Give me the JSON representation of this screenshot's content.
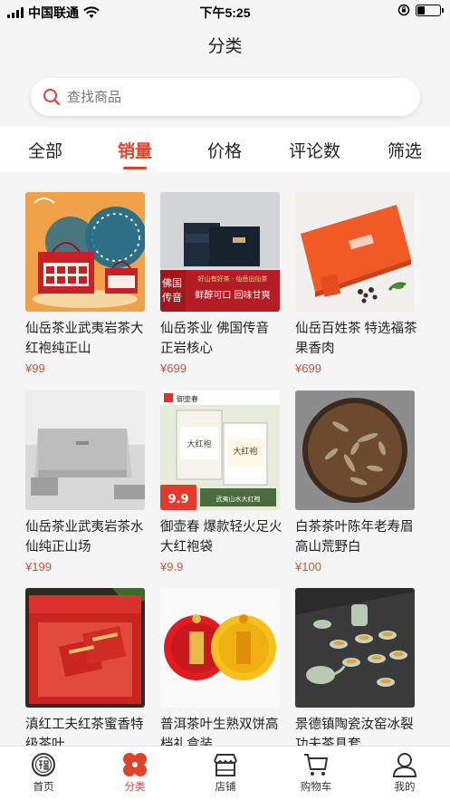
{
  "status_bar": {
    "carrier": "中国联通",
    "time": "下午5:25"
  },
  "nav": {
    "title": "分类"
  },
  "search": {
    "placeholder": "查找商品"
  },
  "tabs": [
    {
      "label": "全部",
      "active": false
    },
    {
      "label": "销量",
      "active": true
    },
    {
      "label": "价格",
      "active": false
    },
    {
      "label": "评论数",
      "active": false
    },
    {
      "label": "筛选",
      "active": false
    }
  ],
  "products": [
    {
      "name": "仙岳茶业武夷岩茶大红袍纯正山",
      "price": "¥99",
      "image": "red-tea-gift-box-with-fans"
    },
    {
      "name": "仙岳茶业 佛国传音 正岩核心",
      "price": "¥699",
      "image": "black-tea-gift-box",
      "image_text": {
        "left": "佛国传音",
        "right": "鲜醇可口 回味甘爽",
        "top": "好山有好茶 · 仙岳出仙茶"
      }
    },
    {
      "name": "仙岳百姓茶 特选福茶 果香肉",
      "price": "¥699",
      "image": "orange-tea-box"
    },
    {
      "name": "仙岳茶业武夷岩茶水仙纯正山场",
      "price": "¥199",
      "image": "white-tea-box"
    },
    {
      "name": "御壶春 爆款轻火足火大红袍袋",
      "price": "¥9.9",
      "image": "dahongpao-bags",
      "image_text": {
        "brand": "御壶春",
        "badge": "9.9",
        "note": "武夷山水大红袍",
        "bag": "大红袍"
      }
    },
    {
      "name": "白茶茶叶陈年老寿眉高山荒野白",
      "price": "¥100",
      "image": "white-tea-cake"
    },
    {
      "name": "滇红工夫红茶蜜香特级茶叶",
      "price": "",
      "image": "red-tea-tins-box"
    },
    {
      "name": "普洱茶叶生熟双饼高档礼盒装",
      "price": "",
      "image": "puer-tea-cakes"
    },
    {
      "name": "景德镇陶瓷汝窑冰裂功夫茶具套",
      "price": "",
      "image": "celadon-tea-set"
    }
  ],
  "tabbar": [
    {
      "label": "首页",
      "icon": "home-fu-icon",
      "active": false
    },
    {
      "label": "分类",
      "icon": "category-icon",
      "active": true
    },
    {
      "label": "店铺",
      "icon": "shop-icon",
      "active": false
    },
    {
      "label": "购物车",
      "icon": "cart-icon",
      "active": false
    },
    {
      "label": "我的",
      "icon": "profile-icon",
      "active": false
    }
  ],
  "colors": {
    "accent": "#e0432d",
    "price": "#c0574a",
    "background": "#f5f5f5"
  }
}
